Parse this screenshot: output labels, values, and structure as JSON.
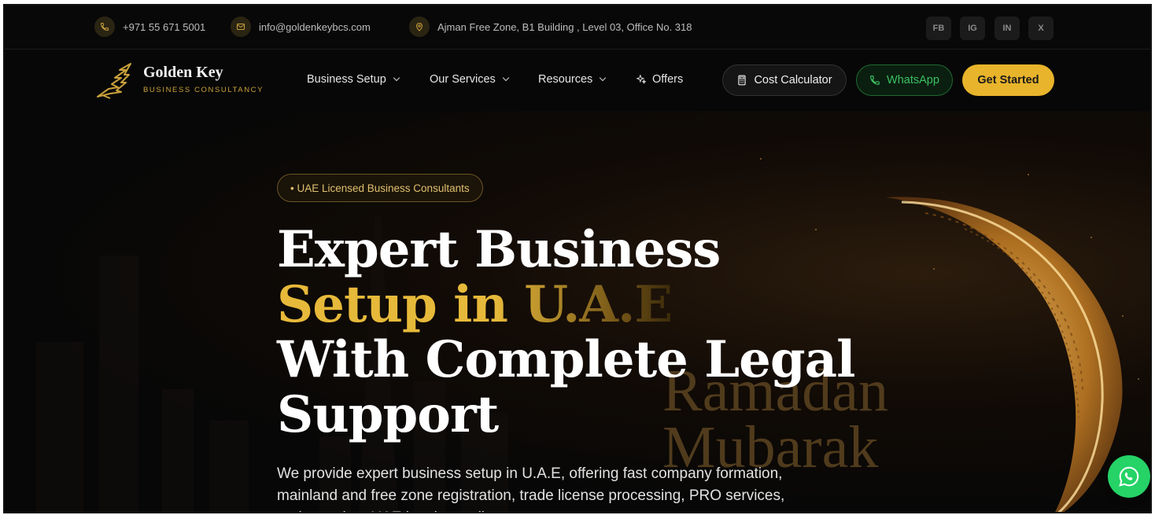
{
  "topbar": {
    "phone": "+971 55 671 5001",
    "email": "info@goldenkeybcs.com",
    "address": "Ajman Free Zone, B1 Building , Level 03, Office No. 318",
    "social": [
      "FB",
      "IG",
      "IN",
      "X"
    ]
  },
  "brand": {
    "name": "Golden Key",
    "tagline": "BUSINESS CONSULTANCY"
  },
  "nav": {
    "items": [
      {
        "label": "Business Setup",
        "icon": "chevron-down-icon"
      },
      {
        "label": "Our Services",
        "icon": "chevron-down-icon"
      },
      {
        "label": "Resources",
        "icon": "chevron-down-icon"
      },
      {
        "label": "Offers",
        "icon": "sparkle-icon"
      }
    ],
    "cost_calculator": "Cost Calculator",
    "whatsapp": "WhatsApp",
    "get_started": "Get Started"
  },
  "hero": {
    "badge": "• UAE Licensed Business Consultants",
    "headline_line1": "Expert Business",
    "headline_line2": "Setup in U.A.E",
    "headline_line3": "With Complete Legal",
    "headline_line4": "Support",
    "description": "We provide expert business setup in U.A.E, offering fast company formation, mainland and free zone registration, trade license processing, PRO services, and complete UAE legal compliance support.",
    "banner_line1": "Ramadan",
    "banner_line2": "Mubarak"
  },
  "colors": {
    "accent": "#e8b42b",
    "whatsapp": "#25d366",
    "background": "#070707"
  }
}
